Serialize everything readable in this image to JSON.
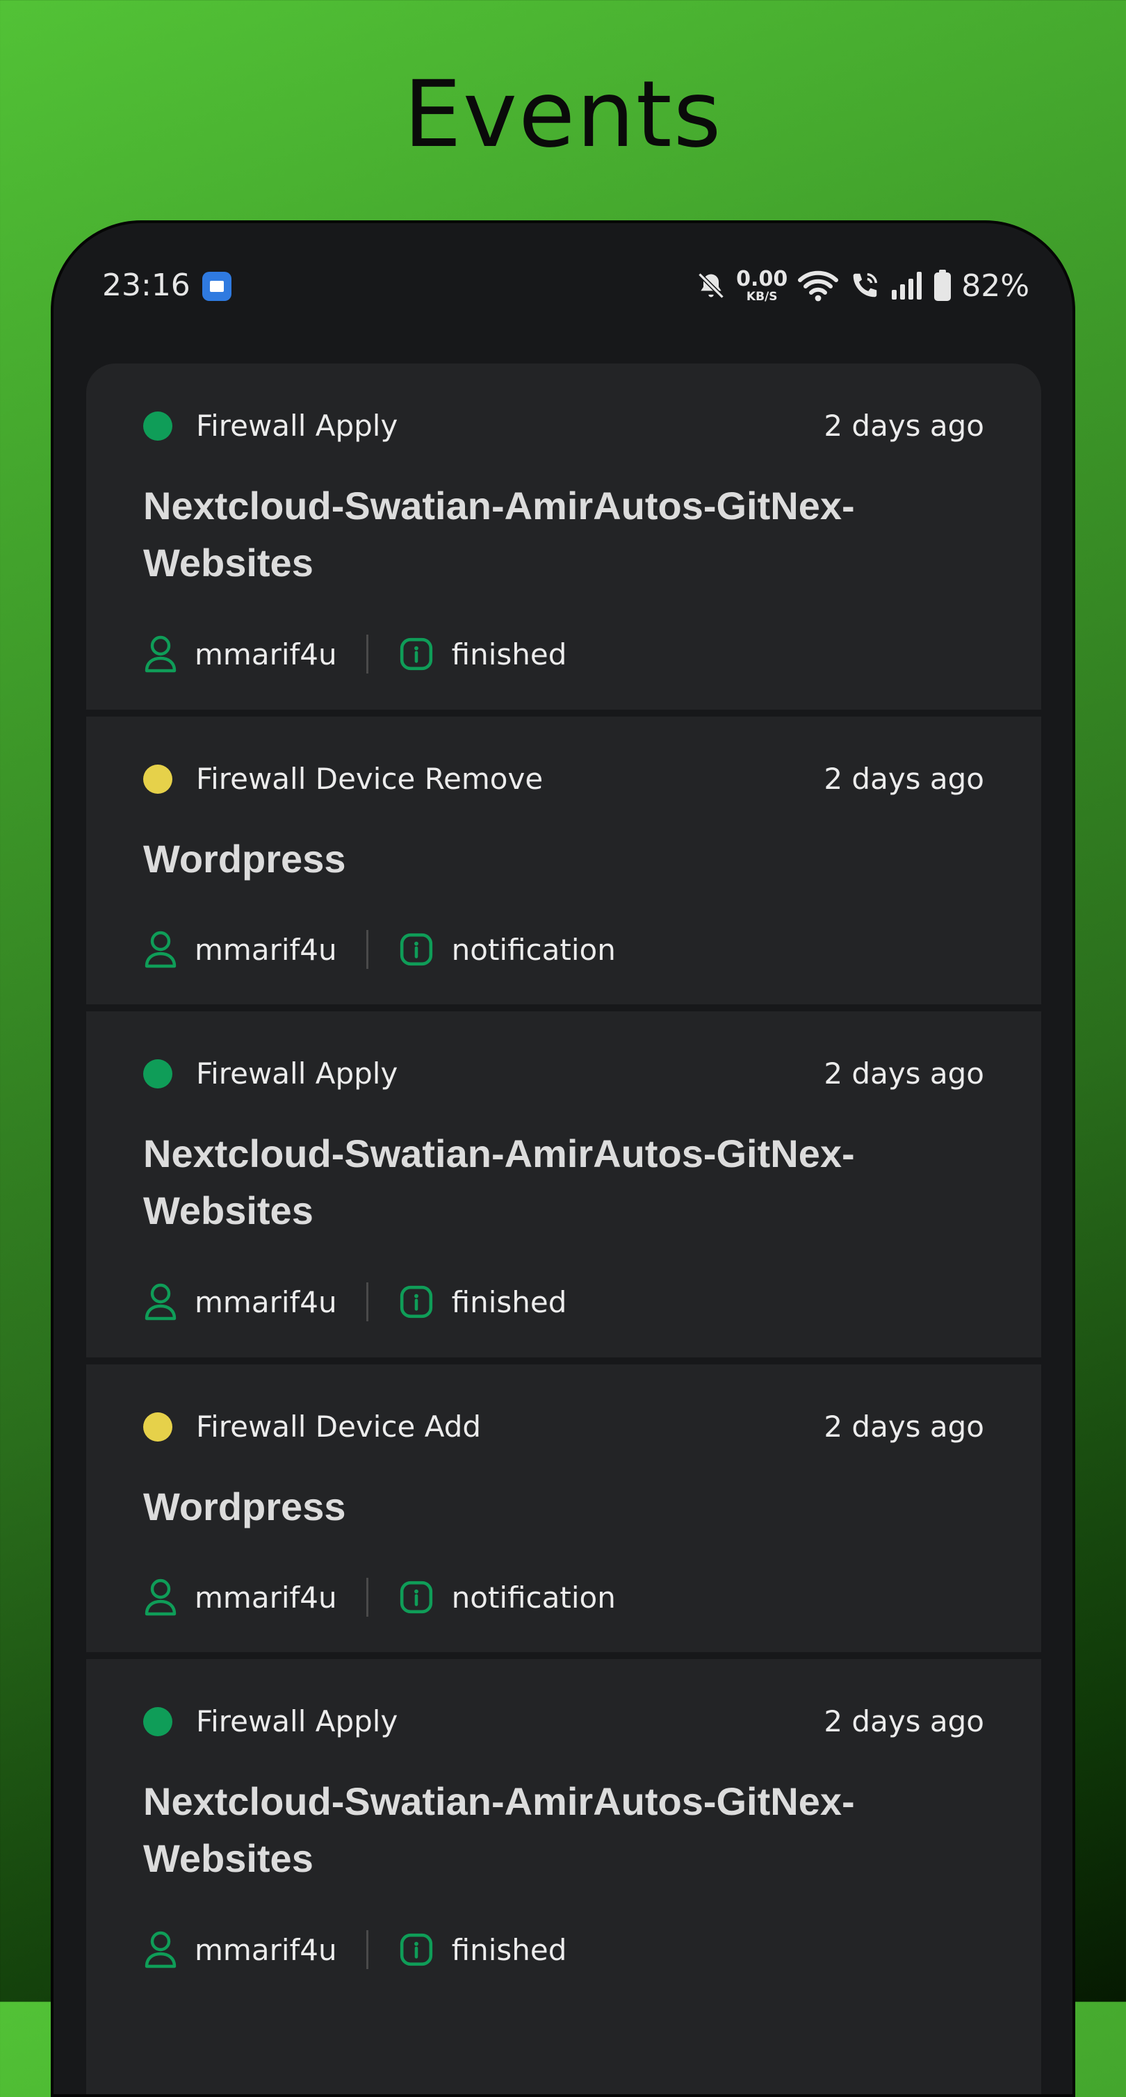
{
  "header": {
    "title": "Events"
  },
  "status_bar": {
    "time": "23:16",
    "net_speed_value": "0.00",
    "net_speed_unit": "KB/S",
    "battery": "82%"
  },
  "colors": {
    "accent": "#0f9d58",
    "warning": "#e6d14a",
    "card_bg": "#232426"
  },
  "events": [
    {
      "type": "Firewall Apply",
      "time": "2 days ago",
      "title": "Nextcloud-Swatian-AmirAutos-GitNex-Websites",
      "user": "mmarif4u",
      "status": "finished",
      "dot": "green"
    },
    {
      "type": "Firewall Device Remove",
      "time": "2 days ago",
      "title": "Wordpress",
      "user": "mmarif4u",
      "status": "notification",
      "dot": "yellow"
    },
    {
      "type": "Firewall Apply",
      "time": "2 days ago",
      "title": "Nextcloud-Swatian-AmirAutos-GitNex-Websites",
      "user": "mmarif4u",
      "status": "finished",
      "dot": "green"
    },
    {
      "type": "Firewall Device Add",
      "time": "2 days ago",
      "title": "Wordpress",
      "user": "mmarif4u",
      "status": "notification",
      "dot": "yellow"
    },
    {
      "type": "Firewall Apply",
      "time": "2 days ago",
      "title": "Nextcloud-Swatian-AmirAutos-GitNex-Websites",
      "user": "mmarif4u",
      "status": "finished",
      "dot": "green"
    }
  ]
}
